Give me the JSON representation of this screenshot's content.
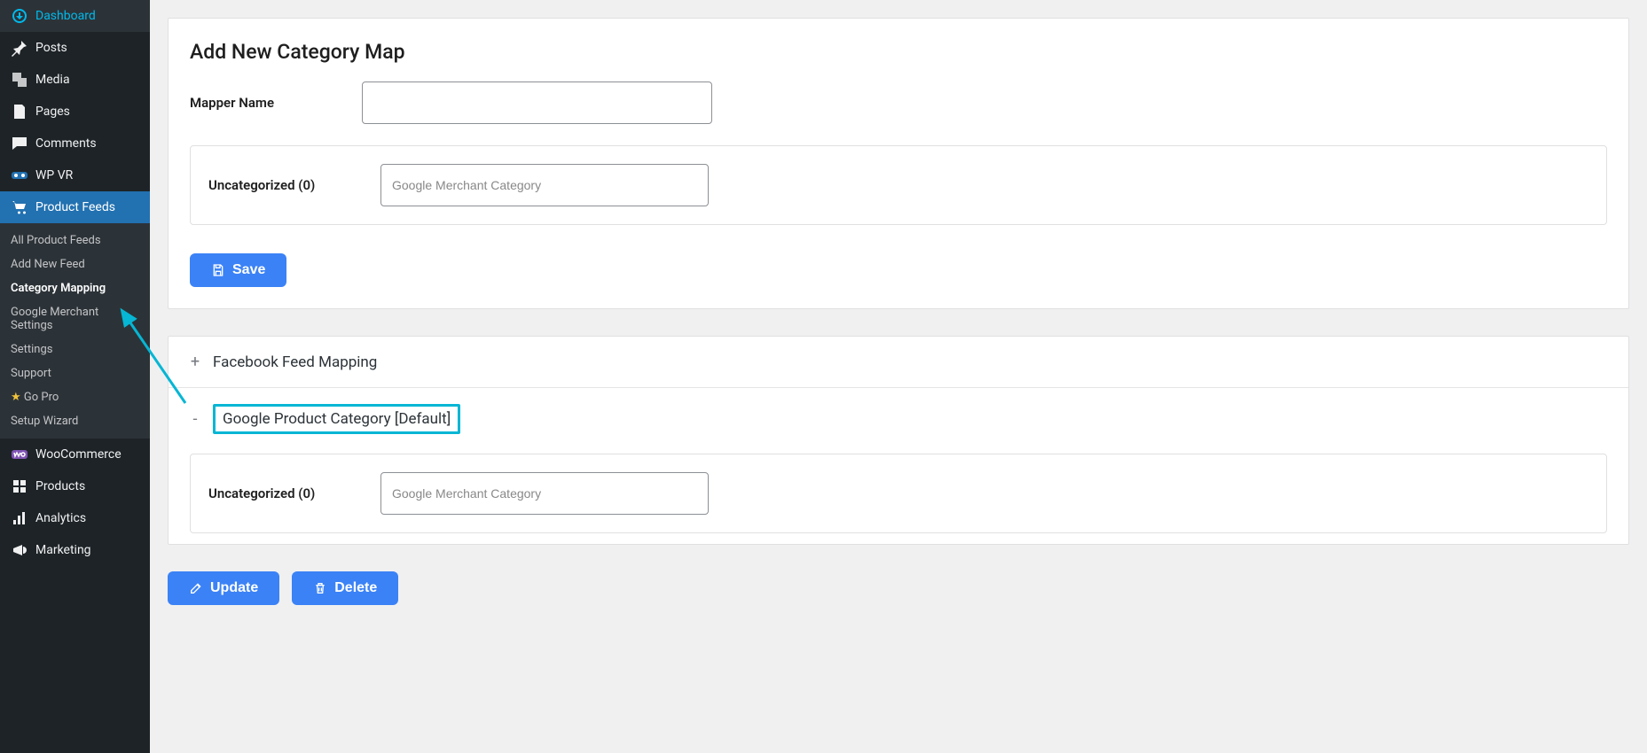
{
  "sidebar": {
    "items": [
      {
        "label": "Dashboard"
      },
      {
        "label": "Posts"
      },
      {
        "label": "Media"
      },
      {
        "label": "Pages"
      },
      {
        "label": "Comments"
      },
      {
        "label": "WP VR"
      },
      {
        "label": "Product Feeds"
      },
      {
        "label": "WooCommerce"
      },
      {
        "label": "Products"
      },
      {
        "label": "Analytics"
      },
      {
        "label": "Marketing"
      }
    ],
    "submenu": [
      {
        "label": "All Product Feeds"
      },
      {
        "label": "Add New Feed"
      },
      {
        "label": "Category Mapping"
      },
      {
        "label": "Google Merchant Settings"
      },
      {
        "label": "Settings"
      },
      {
        "label": "Support"
      },
      {
        "label": "Go Pro"
      },
      {
        "label": "Setup Wizard"
      }
    ]
  },
  "page": {
    "title": "Add New Category Map",
    "mapper_name_label": "Mapper Name",
    "uncategorized_label": "Uncategorized (0)",
    "merchant_placeholder": "Google Merchant Category",
    "save_label": "Save",
    "update_label": "Update",
    "delete_label": "Delete",
    "accordion": {
      "facebook": "Facebook Feed Mapping",
      "google": "Google Product Category [Default]"
    }
  },
  "colors": {
    "accent": "#3b82f6",
    "highlight": "#06b6d4",
    "sidebar_active": "#2271b1"
  }
}
